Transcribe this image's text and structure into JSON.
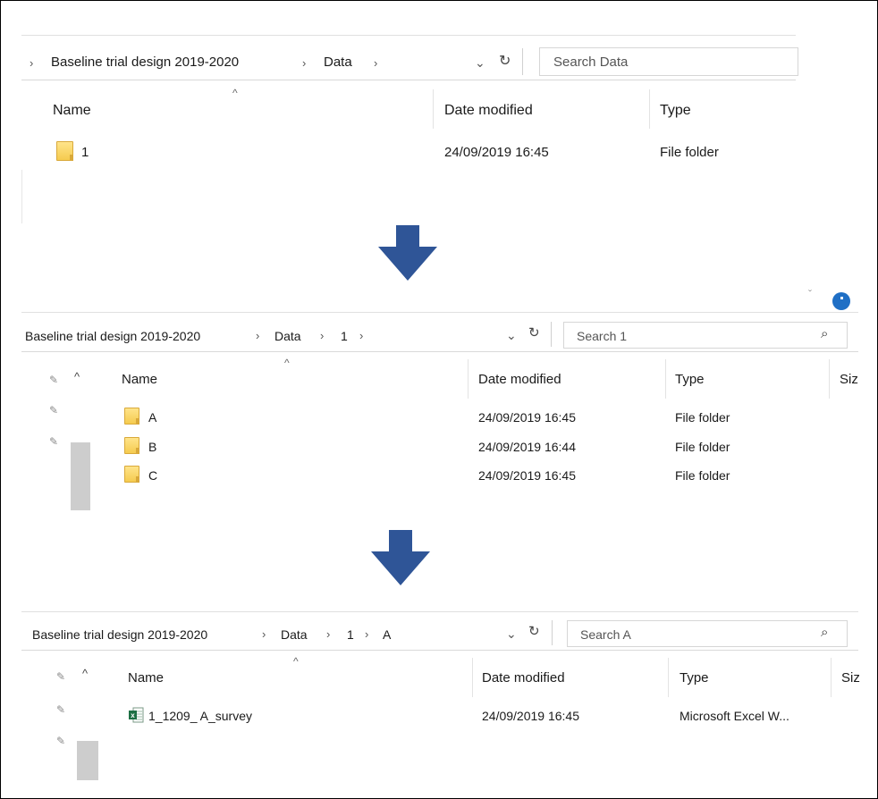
{
  "panel1": {
    "breadcrumb": [
      "Baseline trial design 2019-2020",
      "Data"
    ],
    "search_placeholder": "Search Data",
    "columns": [
      "Name",
      "Date modified",
      "Type"
    ],
    "rows": [
      {
        "name": "1",
        "date": "24/09/2019 16:45",
        "type": "File folder"
      }
    ]
  },
  "panel2": {
    "breadcrumb": [
      "Baseline trial design 2019-2020",
      "Data",
      "1"
    ],
    "search_placeholder": "Search 1",
    "columns": [
      "Name",
      "Date modified",
      "Type",
      "Siz"
    ],
    "rows": [
      {
        "name": "A",
        "date": "24/09/2019 16:45",
        "type": "File folder"
      },
      {
        "name": "B",
        "date": "24/09/2019 16:44",
        "type": "File folder"
      },
      {
        "name": "C",
        "date": "24/09/2019 16:45",
        "type": "File folder"
      }
    ]
  },
  "panel3": {
    "breadcrumb": [
      "Baseline trial design 2019-2020",
      "Data",
      "1",
      "A"
    ],
    "search_placeholder": "Search A",
    "columns": [
      "Name",
      "Date modified",
      "Type",
      "Siz"
    ],
    "rows": [
      {
        "name": "1_1209_ A_survey",
        "date": "24/09/2019 16:45",
        "type": "Microsoft Excel W..."
      }
    ]
  },
  "icons": {
    "arrow_color": "#2f5597",
    "folder_color": "#f5cb4f",
    "excel_color": "#1d7044"
  }
}
